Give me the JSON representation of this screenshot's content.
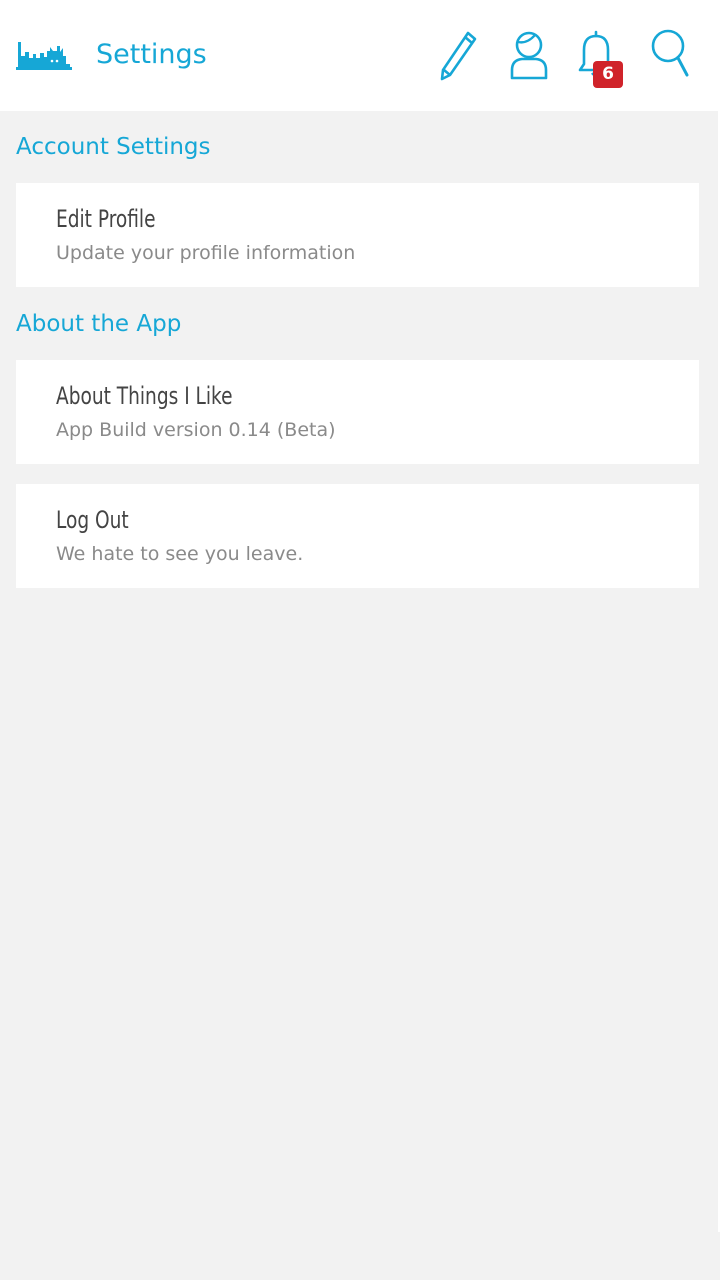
{
  "header": {
    "title": "Settings",
    "logo_icon": "city-skyline-icon",
    "accent_color": "#16a7d6",
    "actions": [
      {
        "name": "pencil-icon"
      },
      {
        "name": "profile-icon"
      },
      {
        "name": "bell-icon"
      },
      {
        "name": "search-icon"
      }
    ],
    "notification_count": "6",
    "badge_color": "#d0232a"
  },
  "sections": [
    {
      "title": "Account Settings",
      "items": [
        {
          "title": "Edit Profile",
          "subtitle": "Update your profile information"
        }
      ]
    },
    {
      "title": "About the App",
      "items": [
        {
          "title": "About Things I Like",
          "subtitle": "App Build version 0.14 (Beta)"
        },
        {
          "title": "Log Out",
          "subtitle": "We hate to see you leave."
        }
      ]
    }
  ]
}
